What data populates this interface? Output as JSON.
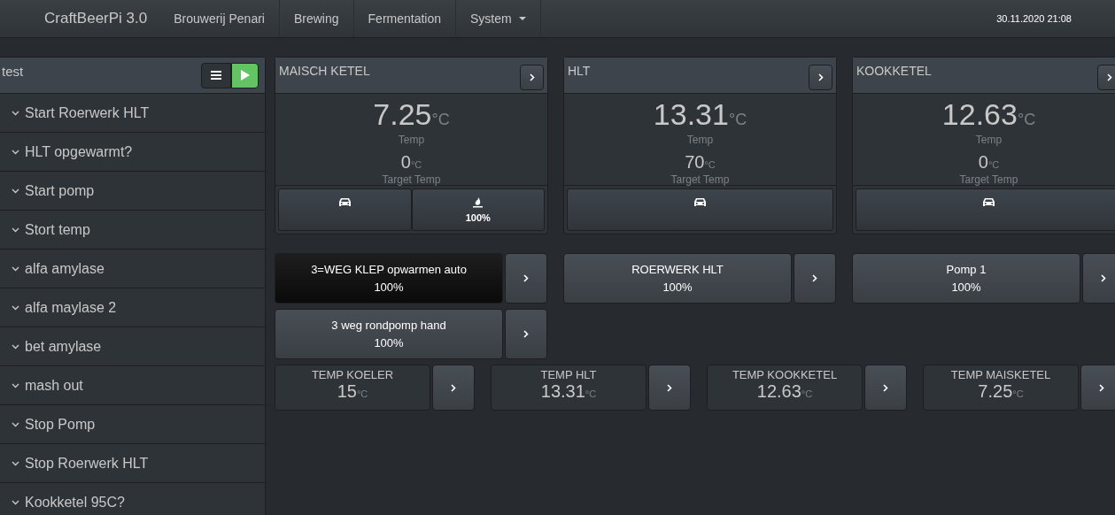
{
  "navbar": {
    "brand": "CraftBeerPi 3.0",
    "items": [
      {
        "label": "Brouwerij Penari",
        "dropdown": false
      },
      {
        "label": "Brewing",
        "dropdown": false
      },
      {
        "label": "Fermentation",
        "dropdown": false
      },
      {
        "label": "System",
        "dropdown": true
      }
    ],
    "datetime": "30.11.2020 21:08"
  },
  "steps": {
    "title": "test",
    "items": [
      "Start Roerwerk HLT",
      "HLT opgewarmt?",
      "Start pomp",
      "Stort temp",
      "alfa amylase",
      "alfa maylase 2",
      "bet amylase",
      "mash out",
      "Stop Pomp",
      "Stop Roerwerk HLT",
      "Kookketel 95C?"
    ]
  },
  "kettles": [
    {
      "name": "MAISCH KETEL",
      "temp": "7.25",
      "unit": "°C",
      "temp_label": "Temp",
      "target": "0",
      "target_unit": "°C",
      "target_label": "Target Temp",
      "buttons": [
        {
          "kind": "agitator"
        },
        {
          "kind": "heater",
          "reading": "100%"
        }
      ]
    },
    {
      "name": "HLT",
      "temp": "13.31",
      "unit": "°C",
      "temp_label": "Temp",
      "target": "70",
      "target_unit": "°C",
      "target_label": "Target Temp",
      "buttons": [
        {
          "kind": "agitator"
        }
      ]
    },
    {
      "name": "KOOKKETEL",
      "temp": "12.63",
      "unit": "°C",
      "temp_label": "Temp",
      "target": "0",
      "target_unit": "°C",
      "target_label": "Target Temp",
      "buttons": [
        {
          "kind": "agitator"
        }
      ]
    }
  ],
  "actors": [
    {
      "name": "3=WEG KLEP opwarmen auto",
      "reading": "100%",
      "on": true
    },
    {
      "name": "ROERWERK HLT",
      "reading": "100%",
      "on": false
    },
    {
      "name": "Pomp 1",
      "reading": "100%",
      "on": false
    },
    {
      "name": "3 weg rondpomp hand",
      "reading": "100%",
      "on": false
    }
  ],
  "sensors": [
    {
      "name": "TEMP KOELER",
      "value": "15",
      "unit": "°C"
    },
    {
      "name": "TEMP HLT",
      "value": "13.31",
      "unit": "°C"
    },
    {
      "name": "TEMP KOOKKETEL",
      "value": "12.63",
      "unit": "°C"
    },
    {
      "name": "TEMP MAISKETEL",
      "value": "7.25",
      "unit": "°C"
    }
  ]
}
